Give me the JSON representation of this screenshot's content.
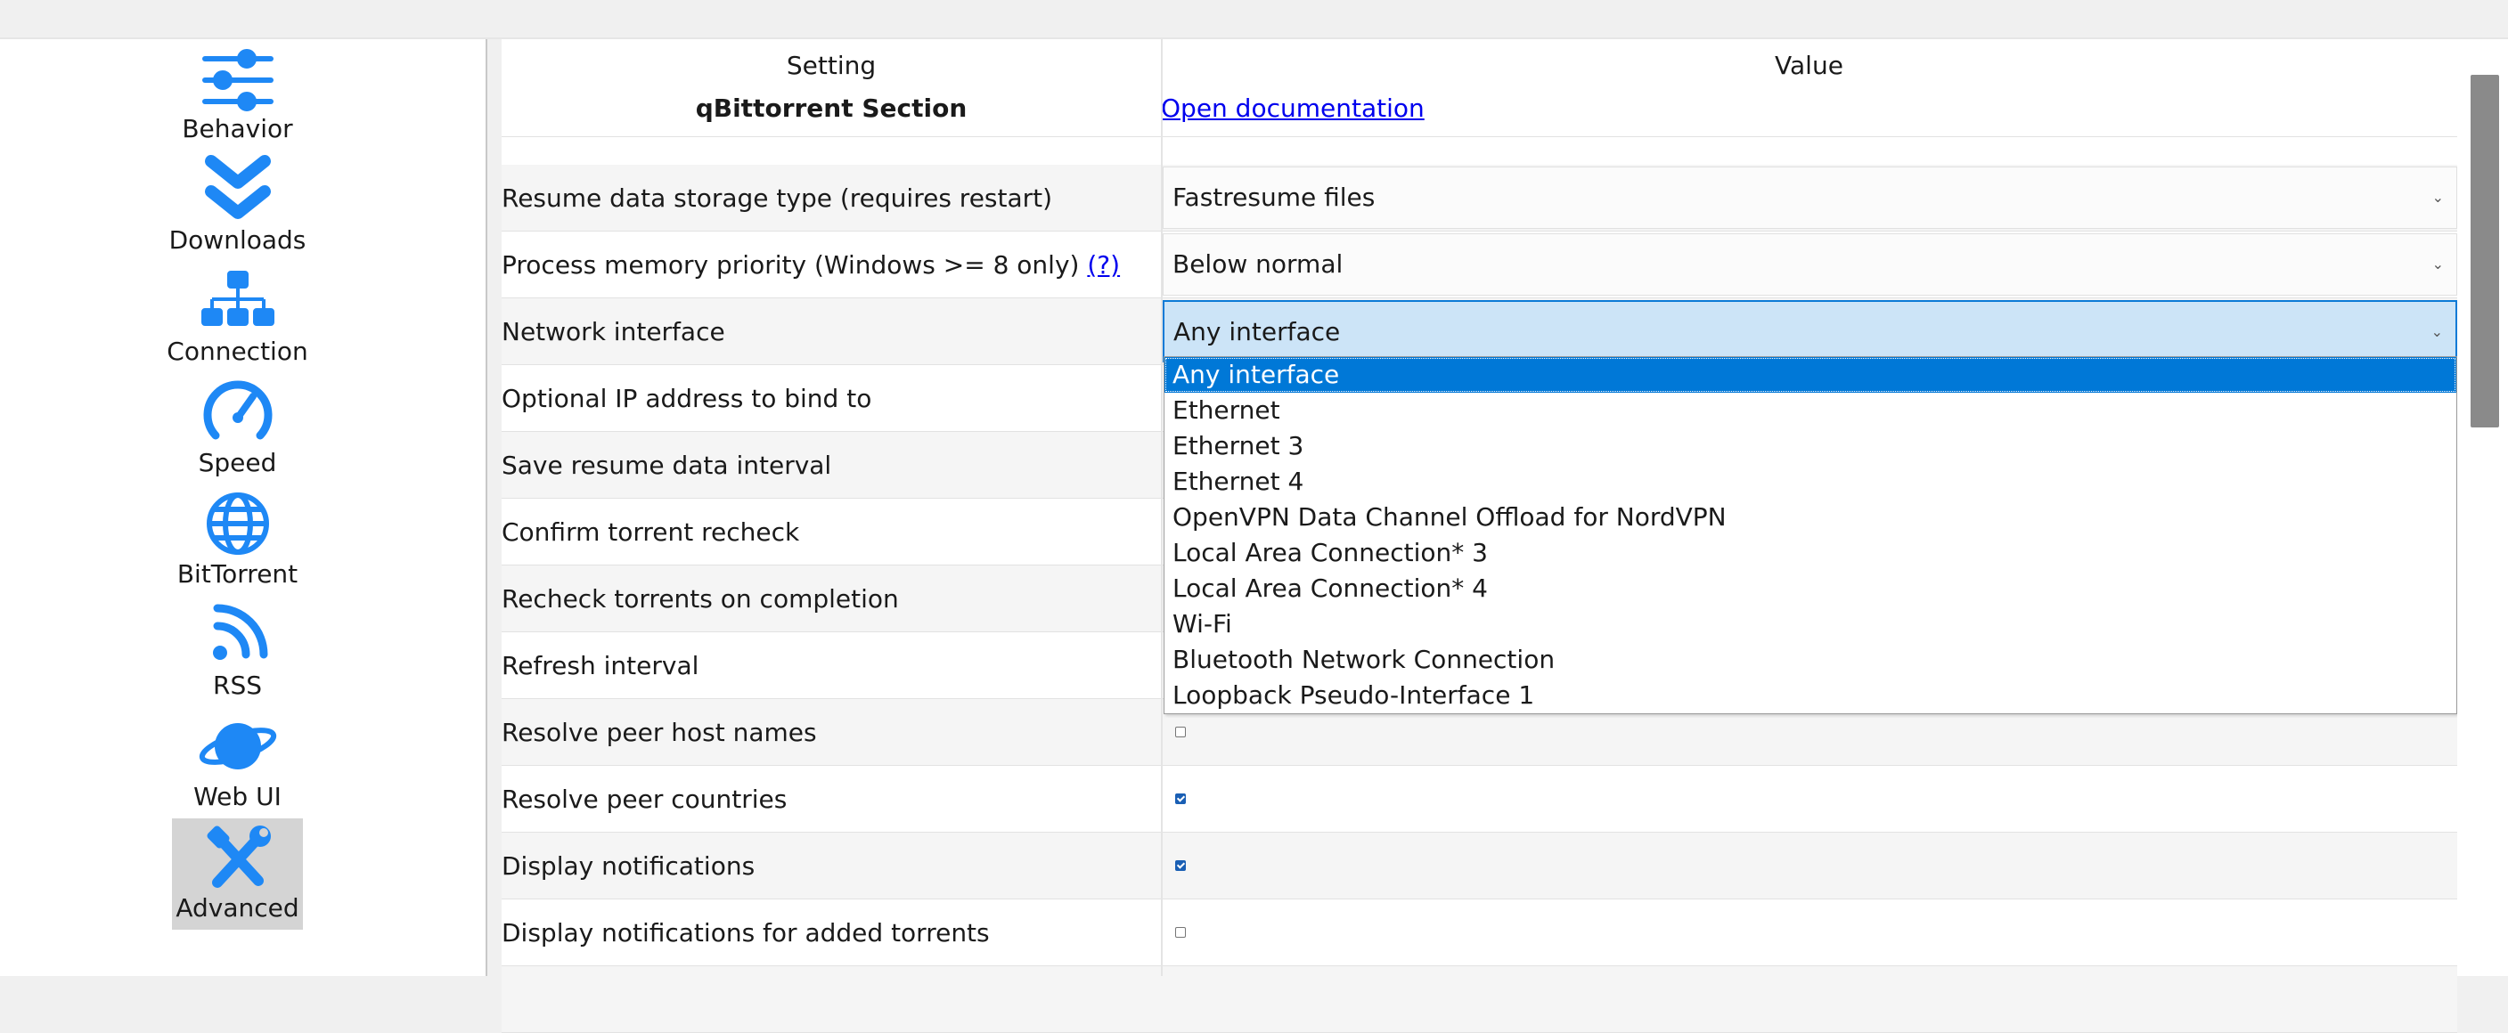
{
  "sidebar": {
    "items": [
      {
        "label": "Behavior",
        "icon": "sliders-icon"
      },
      {
        "label": "Downloads",
        "icon": "double-chevron-down-icon"
      },
      {
        "label": "Connection",
        "icon": "network-icon"
      },
      {
        "label": "Speed",
        "icon": "speedometer-icon"
      },
      {
        "label": "BitTorrent",
        "icon": "globe-icon"
      },
      {
        "label": "RSS",
        "icon": "rss-icon"
      },
      {
        "label": "Web UI",
        "icon": "planet-icon"
      },
      {
        "label": "Advanced",
        "icon": "tools-icon",
        "selected": true
      }
    ],
    "icon_color": "#1e88f5"
  },
  "table": {
    "headers": {
      "setting": "Setting",
      "value": "Value"
    },
    "section_title": "qBittorrent Section",
    "doc_link": "Open documentation",
    "rows": [
      {
        "name": "Resume data storage type (requires restart)",
        "type": "select",
        "value": "Fastresume files"
      },
      {
        "name": "Process memory priority (Windows >= 8 only)",
        "help_link": "(?)",
        "type": "select",
        "value": "Below normal"
      },
      {
        "name": "Network interface",
        "type": "select",
        "value": "Any interface",
        "open": true
      },
      {
        "name": "Optional IP address to bind to"
      },
      {
        "name": "Save resume data interval"
      },
      {
        "name": "Confirm torrent recheck"
      },
      {
        "name": "Recheck torrents on completion"
      },
      {
        "name": "Refresh interval"
      },
      {
        "name": "Resolve peer host names",
        "type": "checkbox",
        "checked": false
      },
      {
        "name": "Resolve peer countries",
        "type": "checkbox",
        "checked": true
      },
      {
        "name": "Display notifications",
        "type": "checkbox",
        "checked": true
      },
      {
        "name": "Display notifications for added torrents",
        "type": "checkbox",
        "checked": false
      }
    ]
  },
  "dropdown": {
    "options": [
      "Any interface",
      "Ethernet",
      "Ethernet 3",
      "Ethernet 4",
      "OpenVPN Data Channel Offload for NordVPN",
      "Local Area Connection* 3",
      "Local Area Connection* 4",
      "Wi-Fi",
      "Bluetooth Network Connection",
      "Loopback Pseudo-Interface 1"
    ],
    "selected_index": 0
  },
  "colors": {
    "accent": "#0078d7",
    "link": "#0000ee",
    "selection_bg": "#cce4f7"
  }
}
